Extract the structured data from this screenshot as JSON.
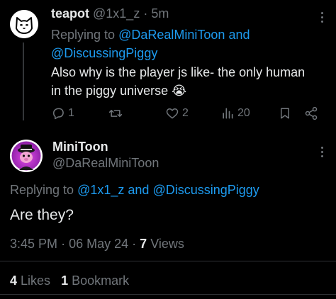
{
  "reply_tweet": {
    "name": "teapot",
    "handle": "@1x1_z",
    "sep": "·",
    "time": "5m",
    "replying_prefix": "Replying to",
    "replying_user1": "@DaRealMiniToon",
    "replying_and": "and",
    "replying_user2": "@DiscussingPiggy",
    "text_line1": "Also why is the player js like- the only human",
    "text_line2": "in the piggy universe",
    "emoji": "😭",
    "actions": {
      "replies": "1",
      "retweets": "",
      "likes": "2",
      "views": "20"
    }
  },
  "main_tweet": {
    "name": "MiniToon",
    "handle": "@DaRealMiniToon",
    "replying_prefix": "Replying to",
    "replying_user1": "@1x1_z",
    "replying_and": "and",
    "replying_user2": "@DiscussingPiggy",
    "text": "Are they?",
    "time": "3:45 PM",
    "sep1": "·",
    "date": "06 May 24",
    "sep2": "·",
    "views_count": "7",
    "views_label": "Views"
  },
  "stats": {
    "likes_count": "4",
    "likes_label": "Likes",
    "bookmarks_count": "1",
    "bookmarks_label": "Bookmark"
  },
  "colors": {
    "background": "#000000",
    "text": "#e7e9ea",
    "muted": "#71767b",
    "link": "#1d9bf0",
    "divider": "#2f3336",
    "main_avatar_accent": "#c13bd6"
  }
}
